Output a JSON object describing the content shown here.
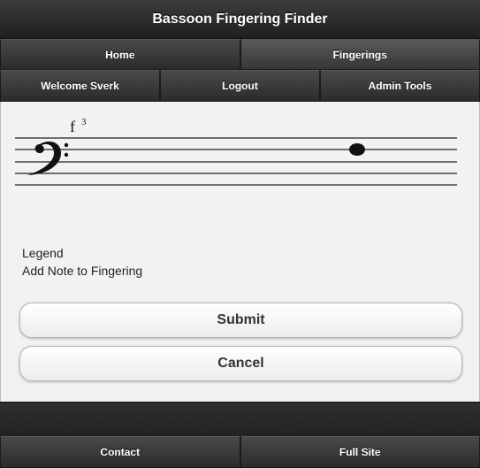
{
  "header": {
    "title": "Bassoon Fingering Finder"
  },
  "nav_primary": [
    {
      "label": "Home"
    },
    {
      "label": "Fingerings"
    }
  ],
  "nav_secondary": [
    {
      "label": "Welcome Sverk"
    },
    {
      "label": "Logout"
    },
    {
      "label": "Admin Tools"
    }
  ],
  "staff": {
    "clef": "bass",
    "note_name": "f",
    "octave": "3"
  },
  "legend": {
    "title": "Legend",
    "text": "Add Note to Fingering"
  },
  "buttons": {
    "submit": "Submit",
    "cancel": "Cancel"
  },
  "footer": [
    {
      "label": "Contact"
    },
    {
      "label": "Full Site"
    }
  ]
}
